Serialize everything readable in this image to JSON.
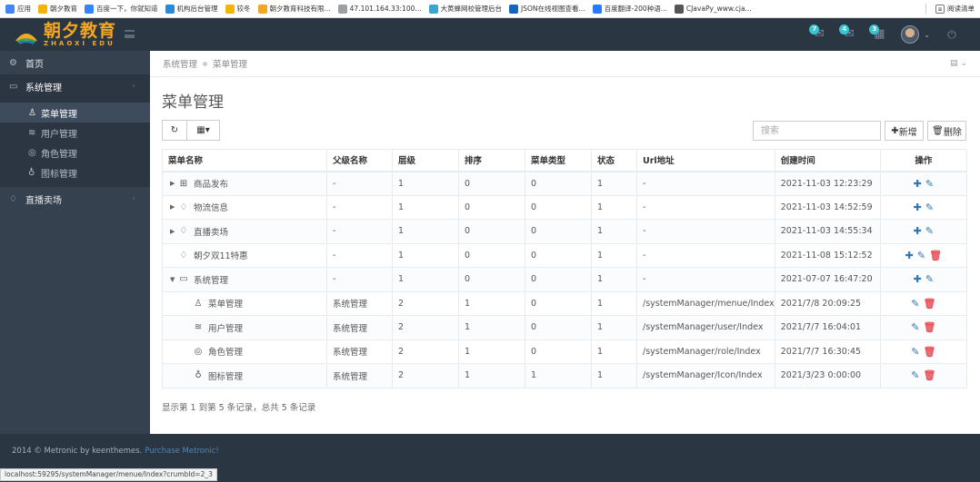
{
  "bookmarks": {
    "items": [
      {
        "label": "应用",
        "color": "#4285f4"
      },
      {
        "label": "朝夕教育",
        "color": "#f4b400"
      },
      {
        "label": "百度一下，你就知道",
        "color": "#3385ff"
      },
      {
        "label": "机构后台管理",
        "color": "#2b8ad8"
      },
      {
        "label": "较冬",
        "color": "#f4b400"
      },
      {
        "label": "朝夕教育科技有限...",
        "color": "#f5a623"
      },
      {
        "label": "47.101.164.33:100...",
        "color": "#9aa0a6"
      },
      {
        "label": "大黄蜂网校管理后台",
        "color": "#3aa6d0"
      },
      {
        "label": "JSON在线视图查看...",
        "color": "#1565c0"
      },
      {
        "label": "百度翻译-200种语...",
        "color": "#2979ff"
      },
      {
        "label": "CJavaPy_www.cja...",
        "color": "#555555"
      }
    ],
    "reading_list": "阅读清单"
  },
  "header": {
    "brand_cn": "朝夕教育",
    "brand_en": "ZHAOXI EDU",
    "badges": [
      "7",
      "4",
      "3"
    ]
  },
  "sidebar": {
    "home": "首页",
    "system": "系统管理",
    "sub_items": [
      "菜单管理",
      "用户管理",
      "角色管理",
      "图标管理"
    ],
    "live": "直播卖场"
  },
  "breadcrumb": {
    "level1": "系统管理",
    "level2": "菜单管理"
  },
  "page": {
    "title": "菜单管理",
    "search_placeholder": "搜索",
    "add_label": "新增",
    "delete_label": "删除",
    "summary": "显示第 1 到第 5 条记录，总共 5 条记录"
  },
  "table": {
    "headers": [
      "菜单名称",
      "父级名称",
      "层级",
      "排序",
      "菜单类型",
      "状态",
      "Url地址",
      "创建时间",
      "操作"
    ],
    "rows": [
      {
        "name": "商品发布",
        "icon": "shop-icon",
        "glyph": "⊞",
        "toggle": "▶",
        "indent": 0,
        "parent": "-",
        "level": "1",
        "sort": "0",
        "type": "0",
        "status": "1",
        "url": "-",
        "created": "2021-11-03 12:23:29",
        "actions": [
          "add",
          "edit"
        ]
      },
      {
        "name": "物流信息",
        "icon": "diamond-icon",
        "glyph": "♢",
        "toggle": "▶",
        "indent": 0,
        "parent": "-",
        "level": "1",
        "sort": "0",
        "type": "0",
        "status": "1",
        "url": "-",
        "created": "2021-11-03 14:52:59",
        "actions": [
          "add",
          "edit"
        ]
      },
      {
        "name": "直播卖场",
        "icon": "diamond-icon",
        "glyph": "♢",
        "toggle": "▶",
        "indent": 0,
        "parent": "-",
        "level": "1",
        "sort": "0",
        "type": "0",
        "status": "1",
        "url": "-",
        "created": "2021-11-03 14:55:34",
        "actions": [
          "add",
          "edit"
        ]
      },
      {
        "name": "朝夕双11特惠",
        "icon": "diamond-icon",
        "glyph": "♢",
        "toggle": "",
        "indent": 0,
        "parent": "-",
        "level": "1",
        "sort": "0",
        "type": "0",
        "status": "1",
        "url": "-",
        "created": "2021-11-08 15:12:52",
        "actions": [
          "add",
          "edit",
          "delete"
        ]
      },
      {
        "name": "系统管理",
        "icon": "folder-icon",
        "glyph": "▭",
        "toggle": "▼",
        "indent": 0,
        "parent": "-",
        "level": "1",
        "sort": "0",
        "type": "0",
        "status": "1",
        "url": "-",
        "created": "2021-07-07 16:47:20",
        "actions": [
          "add",
          "edit"
        ]
      },
      {
        "name": "菜单管理",
        "icon": "user-icon",
        "glyph": "♙",
        "toggle": "",
        "indent": 1,
        "parent": "系统管理",
        "level": "2",
        "sort": "1",
        "type": "0",
        "status": "1",
        "url": "/systemManager/menue/Index",
        "created": "2021/7/8 20:09:25",
        "actions": [
          "edit",
          "delete"
        ]
      },
      {
        "name": "用户管理",
        "icon": "layers-icon",
        "glyph": "≋",
        "toggle": "",
        "indent": 1,
        "parent": "系统管理",
        "level": "2",
        "sort": "1",
        "type": "0",
        "status": "1",
        "url": "/systemManager/user/Index",
        "created": "2021/7/7 16:04:01",
        "actions": [
          "edit",
          "delete"
        ]
      },
      {
        "name": "角色管理",
        "icon": "location-icon",
        "glyph": "◎",
        "toggle": "",
        "indent": 1,
        "parent": "系统管理",
        "level": "2",
        "sort": "1",
        "type": "0",
        "status": "1",
        "url": "/systemManager/role/Index",
        "created": "2021/7/7 16:30:45",
        "actions": [
          "edit",
          "delete"
        ]
      },
      {
        "name": "图标管理",
        "icon": "bulb-icon",
        "glyph": "♁",
        "toggle": "",
        "indent": 1,
        "parent": "系统管理",
        "level": "2",
        "sort": "1",
        "type": "1",
        "status": "1",
        "url": "/systemManager/Icon/Index",
        "created": "2021/3/23 0:00:00",
        "actions": [
          "edit",
          "delete"
        ]
      }
    ]
  },
  "footer": {
    "copyright": "2014 © Metronic by keenthemes.",
    "link": "Purchase Metronic!"
  },
  "status_url": "localhost:59295/systemManager/menue/Index?crumbId=2_3",
  "colors": {
    "accent": "#3175af",
    "danger": "#e7505a",
    "sidebar": "#364150",
    "header": "#2b3643",
    "brand": "#f5a623"
  }
}
